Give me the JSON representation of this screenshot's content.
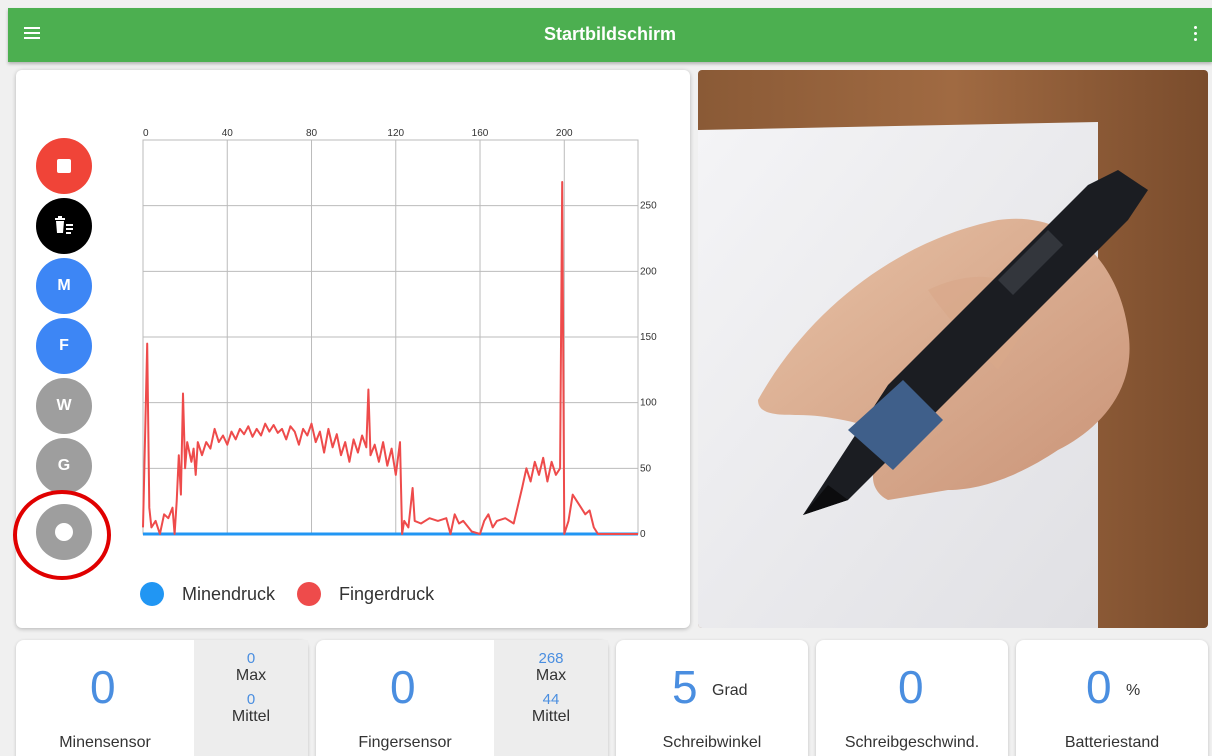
{
  "app_bar": {
    "title": "Startbildschirm",
    "menu_icon": "hamburger-menu-icon",
    "more_icon": "more-vert-icon",
    "color": "#4caf50"
  },
  "side_buttons": [
    {
      "label": "",
      "icon": "stop-icon",
      "color": "#f04438"
    },
    {
      "label": "",
      "icon": "delete-list-icon",
      "color": "#000000"
    },
    {
      "label": "M",
      "color": "#3d86f5"
    },
    {
      "label": "F",
      "color": "#3d86f5"
    },
    {
      "label": "W",
      "color": "#9e9e9e"
    },
    {
      "label": "G",
      "color": "#9e9e9e"
    },
    {
      "label": "",
      "icon": "record-icon",
      "color": "#9e9e9e"
    }
  ],
  "legend": [
    {
      "label": "Minendruck",
      "color": "#2196f3"
    },
    {
      "label": "Fingerdruck",
      "color": "#ee4b4b"
    }
  ],
  "chart_data": {
    "type": "line",
    "x_ticks": [
      "0",
      "40",
      "80",
      "120",
      "160",
      "200"
    ],
    "y_ticks": [
      "0",
      "50",
      "100",
      "150",
      "200",
      "250"
    ],
    "xlim": [
      0,
      235
    ],
    "ylim": [
      0,
      300
    ],
    "grid": true,
    "legend_position": "bottom-left",
    "series": [
      {
        "name": "Minendruck",
        "color": "#2196f3",
        "points": [
          [
            0,
            0
          ],
          [
            235,
            0
          ]
        ]
      },
      {
        "name": "Fingerdruck",
        "color": "#ee4b4b",
        "points": [
          [
            0,
            5
          ],
          [
            2,
            145
          ],
          [
            3,
            20
          ],
          [
            4,
            5
          ],
          [
            6,
            10
          ],
          [
            8,
            0
          ],
          [
            10,
            15
          ],
          [
            12,
            12
          ],
          [
            14,
            20
          ],
          [
            15,
            0
          ],
          [
            16,
            25
          ],
          [
            17,
            60
          ],
          [
            18,
            30
          ],
          [
            19,
            107
          ],
          [
            20,
            50
          ],
          [
            21,
            70
          ],
          [
            23,
            55
          ],
          [
            24,
            65
          ],
          [
            25,
            45
          ],
          [
            26,
            70
          ],
          [
            28,
            60
          ],
          [
            30,
            70
          ],
          [
            32,
            65
          ],
          [
            34,
            80
          ],
          [
            36,
            70
          ],
          [
            38,
            75
          ],
          [
            40,
            68
          ],
          [
            42,
            78
          ],
          [
            44,
            72
          ],
          [
            46,
            80
          ],
          [
            48,
            76
          ],
          [
            50,
            82
          ],
          [
            52,
            74
          ],
          [
            54,
            80
          ],
          [
            56,
            75
          ],
          [
            58,
            84
          ],
          [
            60,
            78
          ],
          [
            62,
            83
          ],
          [
            64,
            77
          ],
          [
            66,
            80
          ],
          [
            68,
            72
          ],
          [
            70,
            82
          ],
          [
            72,
            78
          ],
          [
            74,
            68
          ],
          [
            76,
            80
          ],
          [
            78,
            75
          ],
          [
            80,
            84
          ],
          [
            82,
            70
          ],
          [
            84,
            78
          ],
          [
            86,
            62
          ],
          [
            88,
            80
          ],
          [
            90,
            66
          ],
          [
            92,
            76
          ],
          [
            94,
            60
          ],
          [
            96,
            70
          ],
          [
            98,
            55
          ],
          [
            100,
            72
          ],
          [
            102,
            62
          ],
          [
            104,
            75
          ],
          [
            106,
            66
          ],
          [
            107,
            110
          ],
          [
            108,
            60
          ],
          [
            110,
            68
          ],
          [
            112,
            55
          ],
          [
            114,
            70
          ],
          [
            116,
            52
          ],
          [
            118,
            65
          ],
          [
            120,
            45
          ],
          [
            122,
            70
          ],
          [
            123,
            0
          ],
          [
            124,
            10
          ],
          [
            126,
            5
          ],
          [
            128,
            35
          ],
          [
            129,
            10
          ],
          [
            132,
            8
          ],
          [
            136,
            12
          ],
          [
            140,
            10
          ],
          [
            144,
            12
          ],
          [
            146,
            0
          ],
          [
            148,
            15
          ],
          [
            150,
            8
          ],
          [
            152,
            10
          ],
          [
            156,
            2
          ],
          [
            160,
            0
          ],
          [
            162,
            10
          ],
          [
            164,
            15
          ],
          [
            166,
            5
          ],
          [
            168,
            10
          ],
          [
            172,
            12
          ],
          [
            176,
            8
          ],
          [
            180,
            35
          ],
          [
            182,
            50
          ],
          [
            184,
            40
          ],
          [
            186,
            55
          ],
          [
            188,
            45
          ],
          [
            190,
            58
          ],
          [
            192,
            40
          ],
          [
            194,
            55
          ],
          [
            196,
            45
          ],
          [
            198,
            50
          ],
          [
            199,
            268
          ],
          [
            200,
            0
          ],
          [
            202,
            10
          ],
          [
            204,
            30
          ],
          [
            206,
            25
          ],
          [
            208,
            20
          ],
          [
            210,
            15
          ],
          [
            212,
            18
          ],
          [
            214,
            5
          ],
          [
            216,
            0
          ],
          [
            235,
            0
          ]
        ]
      }
    ]
  },
  "photo": {
    "alt": "hand-holding-pen-photo"
  },
  "bottom_cards": {
    "minensensor": {
      "value": "0",
      "label": "Minensensor",
      "max_value": "0",
      "max_label": "Max",
      "mean_value": "0",
      "mean_label": "Mittel"
    },
    "fingersensor": {
      "value": "0",
      "label": "Fingersensor",
      "max_value": "268",
      "max_label": "Max",
      "mean_value": "44",
      "mean_label": "Mittel"
    },
    "schreibwinkel": {
      "value": "5",
      "unit": "Grad",
      "label": "Schreibwinkel"
    },
    "schreibgeschwind": {
      "value": "0",
      "label": "Schreibgeschwind."
    },
    "batteriestand": {
      "value": "0",
      "unit": "%",
      "label": "Batteriestand"
    }
  }
}
